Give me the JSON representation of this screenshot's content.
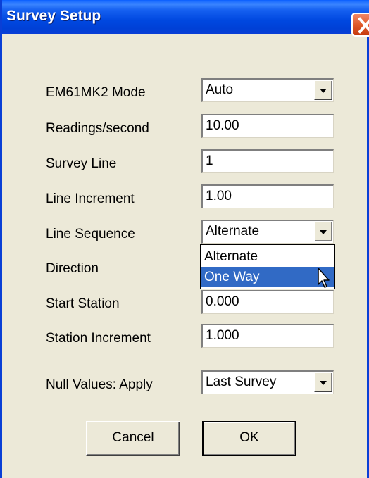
{
  "window": {
    "title": "Survey Setup"
  },
  "fields": {
    "mode": {
      "label": "EM61MK2 Mode",
      "value": "Auto"
    },
    "readings": {
      "label": "Readings/second",
      "value": "10.00"
    },
    "survey_line": {
      "label": "Survey Line",
      "value": "1"
    },
    "line_increment": {
      "label": "Line Increment",
      "value": "1.00"
    },
    "line_sequence": {
      "label": "Line Sequence",
      "value": "Alternate",
      "options": [
        "Alternate",
        "One Way"
      ],
      "highlighted": "One Way"
    },
    "direction": {
      "label": "Direction"
    },
    "start_station": {
      "label": "Start Station",
      "value": "0.000"
    },
    "station_increment": {
      "label": "Station Increment",
      "value": "1.000"
    },
    "null_values": {
      "label": "Null Values:  Apply",
      "value": "Last Survey"
    }
  },
  "buttons": {
    "cancel": "Cancel",
    "ok": "OK"
  },
  "colors": {
    "titlebar": "#0a3fd6",
    "highlight": "#316ac5",
    "face": "#ece9d8"
  }
}
